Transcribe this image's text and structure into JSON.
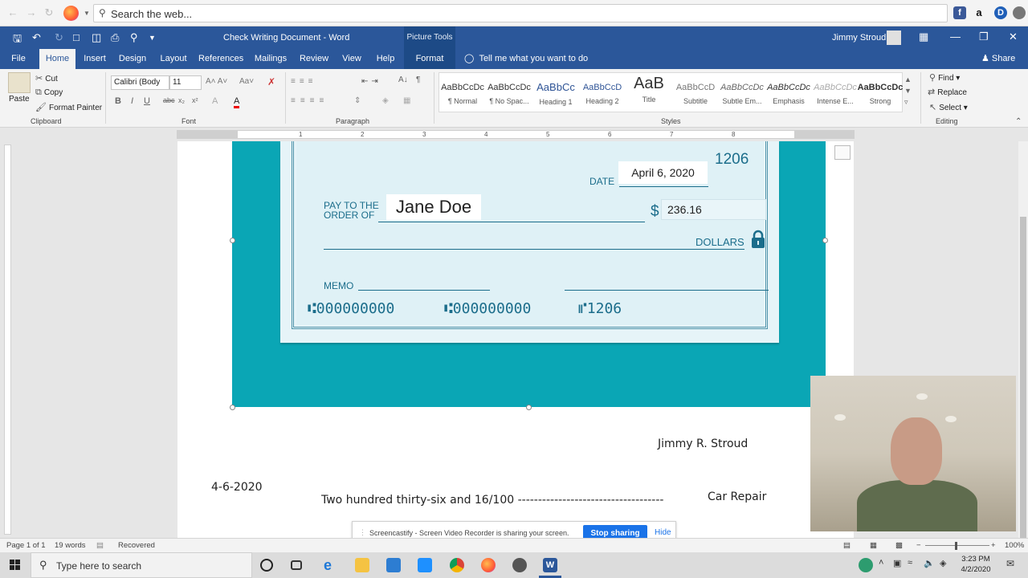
{
  "browser": {
    "search_placeholder": "Search the web...",
    "extensions": [
      "facebook-icon",
      "amazon-icon",
      "dashlane-icon",
      "profile-icon"
    ]
  },
  "word": {
    "doc_title": "Check Writing  Document  -  Word",
    "context_tab": "Picture Tools",
    "user": "Jimmy Stroud",
    "tabs": [
      "File",
      "Home",
      "Insert",
      "Design",
      "Layout",
      "References",
      "Mailings",
      "Review",
      "View",
      "Help",
      "Format"
    ],
    "active_tab": "Home",
    "tell_me": "Tell me what you want to do",
    "share": "Share"
  },
  "ribbon": {
    "clipboard": {
      "paste": "Paste",
      "cut": "Cut",
      "copy": "Copy",
      "format_painter": "Format Painter",
      "label": "Clipboard"
    },
    "font": {
      "name": "Calibri (Body",
      "size": "11",
      "label": "Font"
    },
    "paragraph": {
      "label": "Paragraph"
    },
    "styles": {
      "label": "Styles",
      "items": [
        {
          "preview": "AaBbCcDc",
          "name": "¶ Normal"
        },
        {
          "preview": "AaBbCcDc",
          "name": "¶ No Spac..."
        },
        {
          "preview": "AaBbCc",
          "name": "Heading 1"
        },
        {
          "preview": "AaBbCcD",
          "name": "Heading 2"
        },
        {
          "preview": "AaB",
          "name": "Title"
        },
        {
          "preview": "AaBbCcD",
          "name": "Subtitle"
        },
        {
          "preview": "AaBbCcDc",
          "name": "Subtle Em..."
        },
        {
          "preview": "AaBbCcDc",
          "name": "Emphasis"
        },
        {
          "preview": "AaBbCcDc",
          "name": "Intense E..."
        },
        {
          "preview": "AaBbCcDc",
          "name": "Strong"
        }
      ]
    },
    "editing": {
      "find": "Find",
      "replace": "Replace",
      "select": "Select",
      "label": "Editing"
    }
  },
  "check": {
    "number": "1206",
    "date_label": "DATE",
    "date": "April 6, 2020",
    "payto_line1": "PAY TO THE",
    "payto_line2": "ORDER OF",
    "payee": "Jane Doe",
    "dollar_sign": "$",
    "amount": "236.16",
    "dollars_label": "DOLLARS",
    "memo_label": "MEMO",
    "micr_routing": "⑆000000000",
    "micr_account": "⑆000000000",
    "micr_check": "⑈1206"
  },
  "document": {
    "signer": "Jimmy R. Stroud",
    "date": "4-6-2020",
    "amount_words": "Two hundred thirty-six and 16/100 ------------------------------------",
    "memo": "Car Repair"
  },
  "screencastify": {
    "message": "Screencastify - Screen Video Recorder is sharing your screen.",
    "stop": "Stop sharing",
    "hide": "Hide"
  },
  "status": {
    "page": "Page 1 of 1",
    "words": "19 words",
    "recovered": "Recovered",
    "zoom": "100%"
  },
  "taskbar": {
    "search_placeholder": "Type here to search",
    "time": "3:23 PM",
    "date": "4/2/2020"
  }
}
